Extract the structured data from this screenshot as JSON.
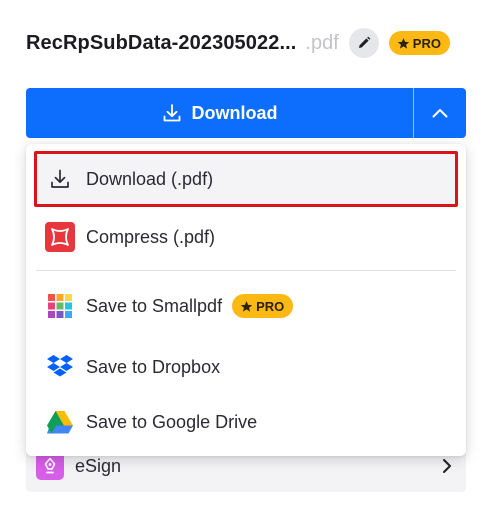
{
  "header": {
    "file_name": "RecRpSubData-202305022...",
    "file_ext": ".pdf",
    "pro_badge": "PRO"
  },
  "download_bar": {
    "label": "Download",
    "color": "#0d6efd"
  },
  "menu": {
    "items": [
      {
        "label": "Download (.pdf)",
        "icon": "download-icon",
        "highlighted": true
      },
      {
        "label": "Compress (.pdf)",
        "icon": "compress-icon"
      },
      {
        "label": "Save to Smallpdf",
        "icon": "smallpdf-icon",
        "badge": "PRO"
      },
      {
        "label": "Save to Dropbox",
        "icon": "dropbox-icon"
      },
      {
        "label": "Save to Google Drive",
        "icon": "google-drive-icon"
      }
    ]
  },
  "esign": {
    "label": "eSign",
    "icon": "esign-icon"
  },
  "colors": {
    "accent": "#0d6efd",
    "pro": "#fdb913",
    "highlight_border": "#d9141c",
    "compress": "#e8363d"
  }
}
